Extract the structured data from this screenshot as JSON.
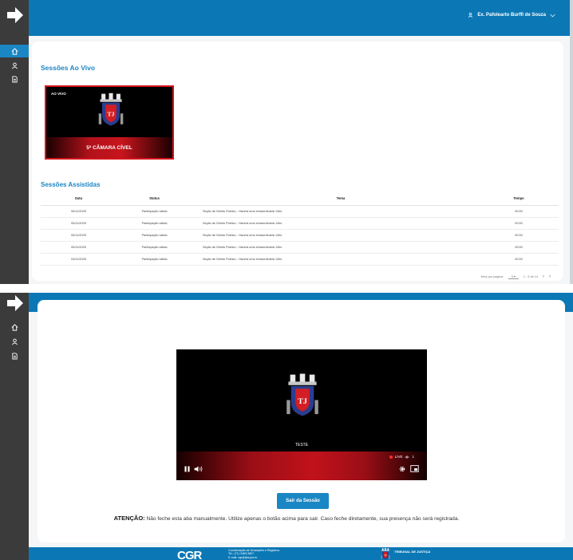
{
  "screen1": {
    "user": {
      "name": "Ex. Pafolearto Burffi de Souza"
    },
    "live_section": {
      "title": "Sessões Ao Vivo",
      "card": {
        "badge": "AO VIVO",
        "title": "5ª CÂMARA CÍVEL"
      }
    },
    "watched_section": {
      "title": "Sessões Assistidas",
      "columns": [
        "Data",
        "Status",
        "Tema",
        "Tempo"
      ],
      "rows": [
        {
          "date": "06/11/2025",
          "status": "Participação válida",
          "theme": "Seção de Direito Público - Haverá uma extraordinária 14hs",
          "time": "00:00"
        },
        {
          "date": "05/11/2025",
          "status": "Participação válida",
          "theme": "Seção de Direito Público - Haverá uma extraordinária 14hs",
          "time": "00:00"
        },
        {
          "date": "05/11/2025",
          "status": "Participação válida",
          "theme": "Seção de Direito Público - Haverá uma extraordinária 14hs",
          "time": "00:00"
        },
        {
          "date": "05/11/2025",
          "status": "Participação válida",
          "theme": "Seção de Direito Público - Haverá uma extraordinária 14hs",
          "time": "00:00"
        },
        {
          "date": "04/11/2025",
          "status": "Participação válida",
          "theme": "Seção de Direito Público - Haverá uma extraordinária 14hs",
          "time": "00:00"
        }
      ],
      "pager": {
        "items_label": "Itens por página:",
        "per_page": "5",
        "range": "1 - 5 de 14"
      }
    }
  },
  "screen2": {
    "player": {
      "caption": "TESTE",
      "live_label": "LIVE",
      "viewers": "1"
    },
    "exit_button": "Sair da Sessão",
    "warning": {
      "prefix": "ATENÇÃO:",
      "text": " Não feche esta aba manualmente. Utilize apenas o botão acima para sair. Caso feche diretamente, sua presença não será registrada."
    },
    "footer": {
      "logo": "CGR",
      "line1": "Coordenação de Gravações e Registros",
      "line2": "Tel.: (71) 3483-3807",
      "line3": "E-mail: cgr@tjba.jus.br",
      "court": "TRIBUNAL DE JUSTIÇA"
    }
  },
  "colors": {
    "primary": "#0b78b5",
    "accent": "#1b86c4",
    "live_red": "#d2141c",
    "rail": "#3b3b3b"
  },
  "icons": [
    "brand-arrow-icon",
    "home-icon",
    "user-icon",
    "document-icon",
    "chevron-down-icon",
    "pause-icon",
    "volume-icon",
    "settings-icon",
    "cast-icon",
    "eye-icon",
    "court-crest-icon"
  ]
}
